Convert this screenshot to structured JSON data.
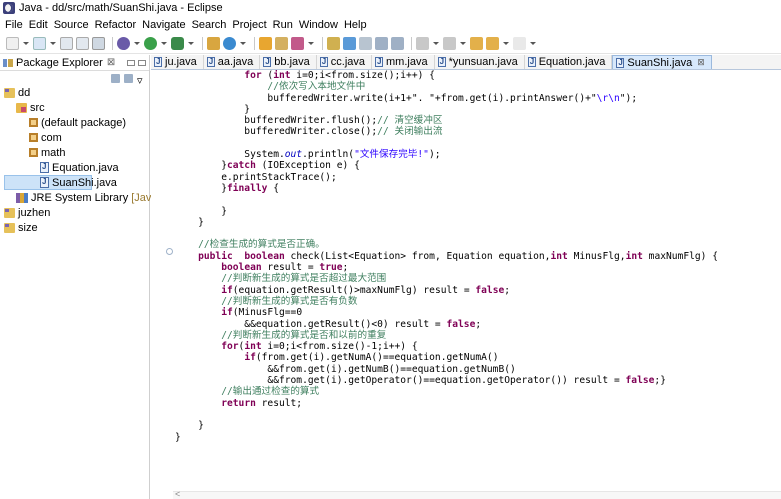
{
  "window": {
    "title": "Java - dd/src/math/SuanShi.java - Eclipse"
  },
  "menu": [
    "File",
    "Edit",
    "Source",
    "Refactor",
    "Navigate",
    "Search",
    "Project",
    "Run",
    "Window",
    "Help"
  ],
  "explorer": {
    "title": "Package Explorer",
    "tree": [
      {
        "label": "dd",
        "icon": "project-icon",
        "level": 0
      },
      {
        "label": "src",
        "icon": "source-folder-icon",
        "level": 1
      },
      {
        "label": "(default package)",
        "icon": "package-icon",
        "level": 2
      },
      {
        "label": "com",
        "icon": "package-icon",
        "level": 2
      },
      {
        "label": "math",
        "icon": "package-icon",
        "level": 2
      },
      {
        "label": "Equation.java",
        "icon": "java-file-icon",
        "level": 3
      },
      {
        "label": "SuanShi.java",
        "icon": "java-file-icon",
        "level": 3,
        "selected": true
      },
      {
        "label": "JRE System Library",
        "suffix": "[JavaS",
        "icon": "library-icon",
        "level": 1
      },
      {
        "label": "juzhen",
        "icon": "project-icon",
        "level": 0
      },
      {
        "label": "size",
        "icon": "project-icon",
        "level": 0
      }
    ]
  },
  "editor": {
    "tabs": [
      {
        "label": "ju.java"
      },
      {
        "label": "aa.java"
      },
      {
        "label": "bb.java"
      },
      {
        "label": "cc.java"
      },
      {
        "label": "mm.java"
      },
      {
        "label": "*yunsuan.java"
      },
      {
        "label": "Equation.java"
      },
      {
        "label": "SuanShi.java",
        "active": true
      }
    ],
    "code": [
      [
        [
          "",
          "            "
        ],
        [
          "kw",
          "for"
        ],
        [
          "",
          " ("
        ],
        [
          "kw",
          "int"
        ],
        [
          "",
          " i=0;i<from.size();i++) {"
        ]
      ],
      [
        [
          "",
          "                "
        ],
        [
          "cm",
          "//依次写入本地文件中"
        ]
      ],
      [
        [
          "",
          "                bufferedWriter.write(i+1+\". \"+from.get(i).printAnswer()+\""
        ],
        [
          "st",
          "\\r\\n"
        ],
        [
          "",
          "\");"
        ]
      ],
      [
        [
          "",
          "            }"
        ]
      ],
      [
        [
          "",
          "            bufferedWriter.flush();"
        ],
        [
          "cm",
          "// 清空缓冲区"
        ]
      ],
      [
        [
          "",
          "            bufferedWriter.close();"
        ],
        [
          "cm",
          "// 关闭输出流"
        ]
      ],
      [
        [
          "",
          ""
        ]
      ],
      [
        [
          "",
          "            System."
        ],
        [
          "it",
          "out"
        ],
        [
          "",
          ".println("
        ],
        [
          "st",
          "\"文件保存完毕!\""
        ],
        [
          "",
          ");"
        ]
      ],
      [
        [
          "",
          "        }"
        ],
        [
          "kw",
          "catch"
        ],
        [
          "",
          " (IOException e) {"
        ]
      ],
      [
        [
          "",
          "        e.printStackTrace();"
        ]
      ],
      [
        [
          "",
          "        }"
        ],
        [
          "kw",
          "finally"
        ],
        [
          "",
          " {"
        ]
      ],
      [
        [
          "",
          ""
        ]
      ],
      [
        [
          "",
          "        }"
        ]
      ],
      [
        [
          "",
          "    }"
        ]
      ],
      [
        [
          "",
          ""
        ]
      ],
      [
        [
          "",
          "    "
        ],
        [
          "cm",
          "//检查生成的算式是否正确。"
        ]
      ],
      [
        [
          "",
          "    "
        ],
        [
          "kw",
          "public"
        ],
        [
          "",
          "  "
        ],
        [
          "kw",
          "boolean"
        ],
        [
          "",
          " check(List<Equation> from, Equation equation,"
        ],
        [
          "kw",
          "int"
        ],
        [
          "",
          " MinusFlg,"
        ],
        [
          "kw",
          "int"
        ],
        [
          "",
          " maxNumFlg) {"
        ]
      ],
      [
        [
          "",
          "        "
        ],
        [
          "kw",
          "boolean"
        ],
        [
          "",
          " result = "
        ],
        [
          "kw",
          "true"
        ],
        [
          "",
          ";"
        ]
      ],
      [
        [
          "",
          "        "
        ],
        [
          "cm",
          "//判断新生成的算式是否超过最大范围"
        ]
      ],
      [
        [
          "",
          "        "
        ],
        [
          "kw",
          "if"
        ],
        [
          "",
          "(equation.getResult()>maxNumFlg) result = "
        ],
        [
          "kw",
          "false"
        ],
        [
          "",
          ";"
        ]
      ],
      [
        [
          "",
          "        "
        ],
        [
          "cm",
          "//判断新生成的算式是否有负数"
        ]
      ],
      [
        [
          "",
          "        "
        ],
        [
          "kw",
          "if"
        ],
        [
          "",
          "(MinusFlg==0"
        ]
      ],
      [
        [
          "",
          "            &&equation.getResult()<0) result = "
        ],
        [
          "kw",
          "false"
        ],
        [
          "",
          ";"
        ]
      ],
      [
        [
          "",
          "        "
        ],
        [
          "cm",
          "//判断新生成的算式是否和以前的重复"
        ]
      ],
      [
        [
          "",
          "        "
        ],
        [
          "kw",
          "for"
        ],
        [
          "",
          "("
        ],
        [
          "kw",
          "int"
        ],
        [
          "",
          " i=0;i<from.size()-1;i++) {"
        ]
      ],
      [
        [
          "",
          "            "
        ],
        [
          "kw",
          "if"
        ],
        [
          "",
          "(from.get(i).getNumA()==equation.getNumA()"
        ]
      ],
      [
        [
          "",
          "                &&from.get(i).getNumB()==equation.getNumB()"
        ]
      ],
      [
        [
          "",
          "                &&from.get(i).getOperator()==equation.getOperator()) result = "
        ],
        [
          "kw",
          "false"
        ],
        [
          "",
          ";}"
        ]
      ],
      [
        [
          "",
          "        "
        ],
        [
          "cm",
          "//输出通过检查的算式"
        ]
      ],
      [
        [
          "",
          "        "
        ],
        [
          "kw",
          "return"
        ],
        [
          "",
          " result;"
        ]
      ],
      [
        [
          "",
          ""
        ]
      ],
      [
        [
          "",
          "    }"
        ]
      ],
      [
        [
          "",
          "}"
        ]
      ]
    ]
  }
}
